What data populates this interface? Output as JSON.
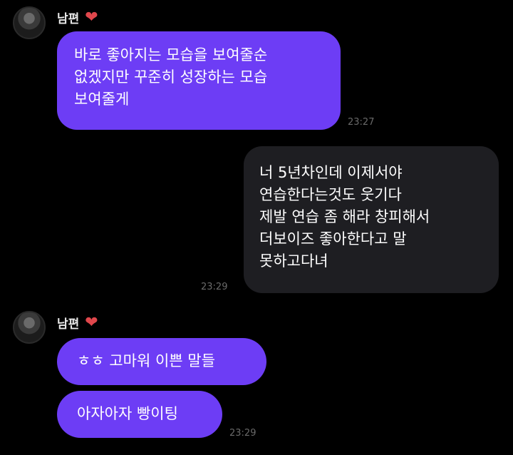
{
  "chat": {
    "group1": {
      "sender": "남편",
      "heart_icon": "heart-icon",
      "message": [
        "바로 좋아지는 모습을 보여줄순",
        "없겠지만 꾸준히 성장하는 모습",
        "보여줄게"
      ],
      "time": "23:27"
    },
    "outgoing": {
      "message": [
        "너 5년차인데 이제서야",
        "연습한다는것도 웃기다",
        "제발 연습 좀 해라 창피해서",
        "더보이즈 좋아한다고 말",
        "못하고다녀"
      ],
      "time": "23:29"
    },
    "group2": {
      "sender": "남편",
      "messages": [
        "ㅎㅎ 고마워 이쁜 말들",
        "아자아자 빵이팅"
      ],
      "time": "23:29"
    }
  },
  "colors": {
    "incoming_bubble": "#6d3df5",
    "outgoing_bubble": "#1e1e22",
    "heart": "#e0474c",
    "background": "#000000"
  }
}
